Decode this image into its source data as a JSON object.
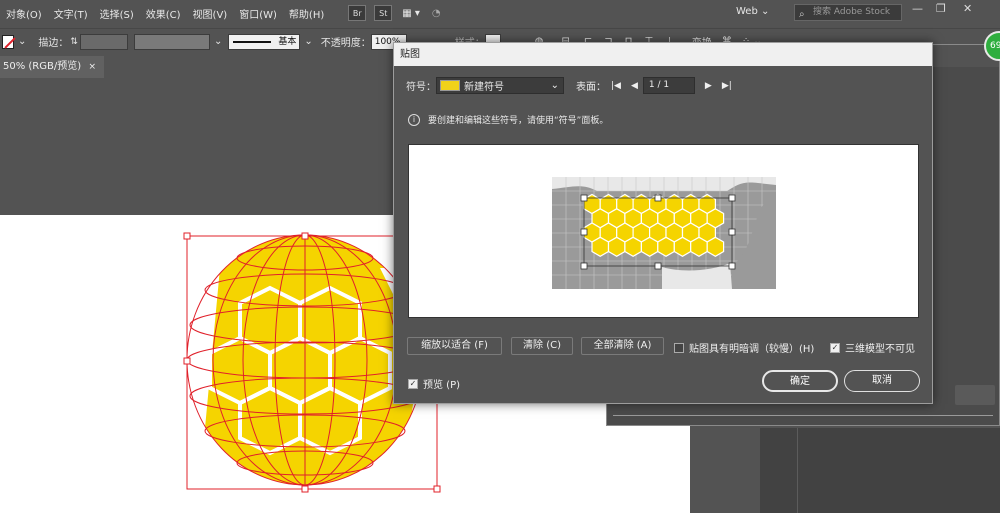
{
  "menu": [
    "对象(O)",
    "文字(T)",
    "选择(S)",
    "效果(C)",
    "视图(V)",
    "窗口(W)",
    "帮助(H)"
  ],
  "app_buttons": [
    "Br",
    "St"
  ],
  "workspace": "Web",
  "search_placeholder": "搜索 Adobe Stock",
  "control": {
    "stroke_label": "描边：",
    "stroke_style": "基本",
    "opacity_label": "不透明度：",
    "opacity_value": "100%",
    "style_label": "样式：",
    "transform_label": "变换"
  },
  "doc_tab": {
    "title": "50% (RGB/预览)",
    "close": "×"
  },
  "badge": "69",
  "dialog": {
    "title": "贴图",
    "symbol_label": "符号：",
    "symbol_value": "新建符号",
    "surface_label": "表面：",
    "surface_page": "1 / 1",
    "info_text": "要创建和编辑这些符号，请使用“符号”面板。",
    "btn_fit": "缩放以适合 (F)",
    "btn_clear": "清除 (C)",
    "btn_clear_all": "全部清除 (A)",
    "check_shade": "贴图具有明暗调（较慢）(H)",
    "check_hide": "三维模型不可见",
    "check_preview": "预览 (P)",
    "btn_ok": "确定",
    "btn_cancel": "取消"
  },
  "colors": {
    "hex_yellow": "#f5d400",
    "wire_red": "#e0202a",
    "ui_gray": "#535353"
  }
}
